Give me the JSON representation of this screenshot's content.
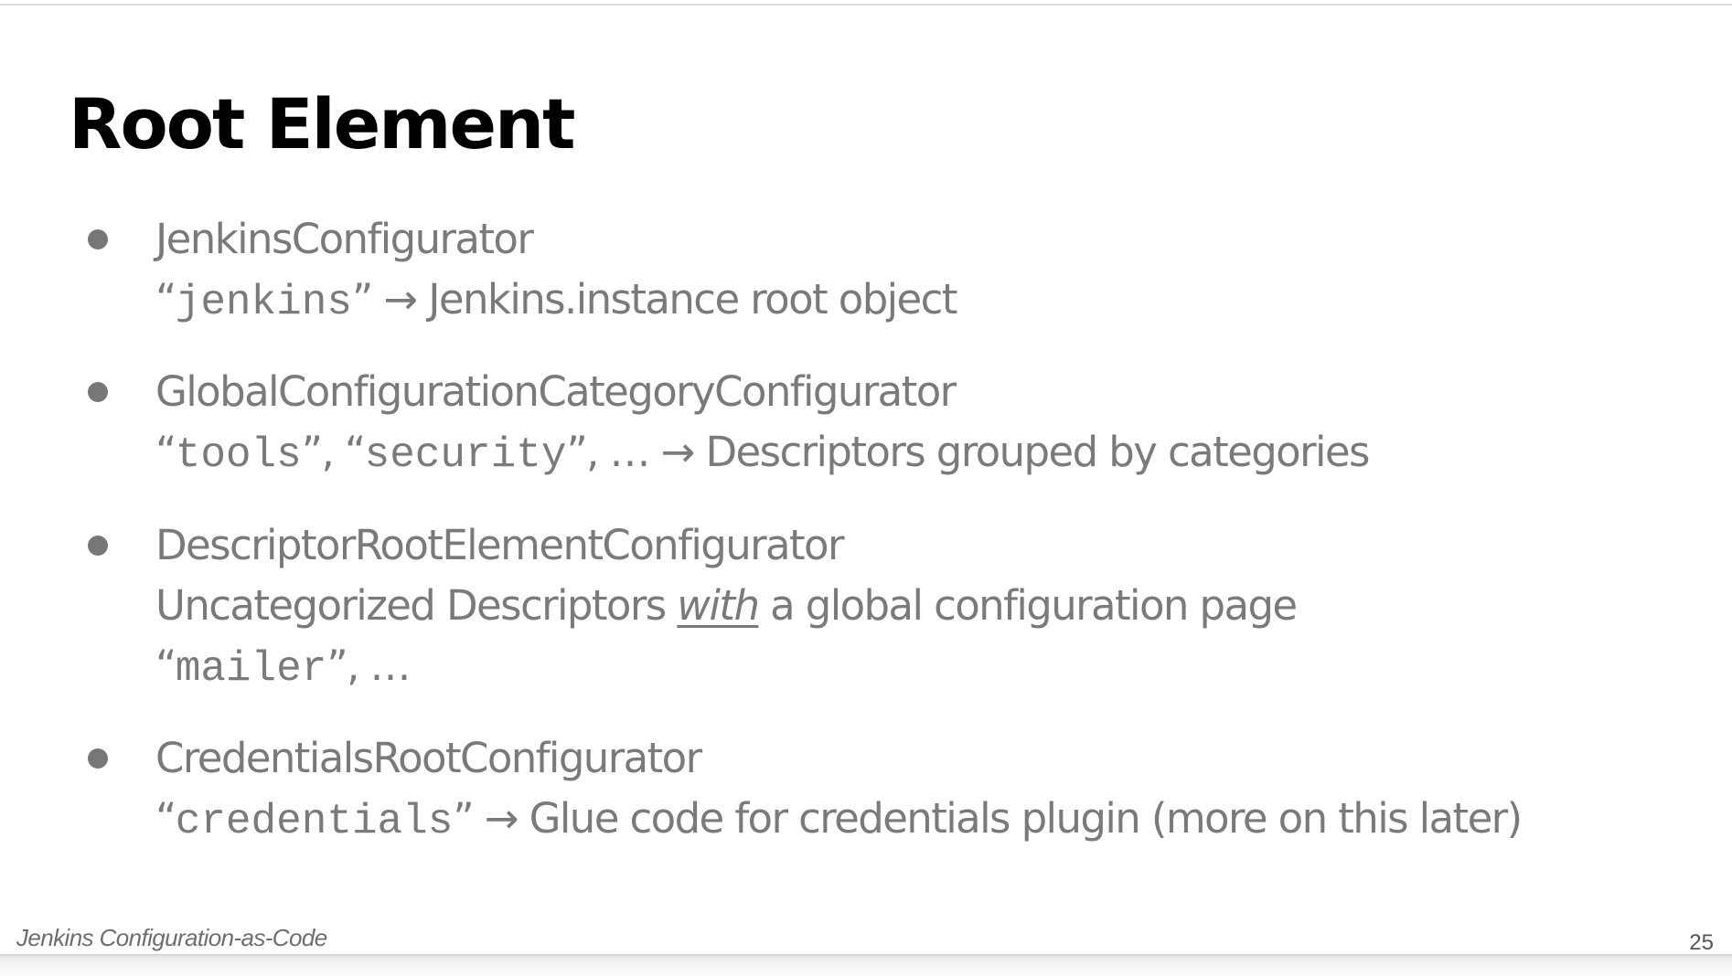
{
  "slide": {
    "title": "Root Element",
    "bullets": [
      {
        "heading": "JenkinsConfigurator",
        "detail": {
          "open_quote": "“",
          "code": "jenkins",
          "close_quote_arrow": "” → ",
          "text": "Jenkins.instance root object"
        }
      },
      {
        "heading": "GlobalConfigurationCategoryConfigurator",
        "detail": {
          "open_quote_1": "“",
          "code_1": "tools",
          "sep": "”, “",
          "code_2": "security",
          "close_and_arrow": "”, … → ",
          "text": "Descriptors grouped by categories"
        }
      },
      {
        "heading": "DescriptorRootElementConfigurator",
        "detail": {
          "text_before": "Uncategorized Descriptors ",
          "emphasis": "with",
          "text_after": " a global configuration page"
        },
        "detail2": {
          "open_quote": "“",
          "code": "mailer",
          "close": "”, …"
        }
      },
      {
        "heading": "CredentialsRootConfigurator",
        "detail": {
          "open_quote": "“",
          "code": "credentials",
          "close_quote_arrow": "” → ",
          "text": "Glue code for credentials plugin (more on this later)"
        }
      }
    ]
  },
  "footer": {
    "presentation_name": "Jenkins Configuration-as-Code",
    "page_number": "25"
  },
  "colors": {
    "title": "#000000",
    "body_text": "#7a7a7a",
    "bullet": "#777777",
    "footer_text": "#6e6e6e"
  }
}
